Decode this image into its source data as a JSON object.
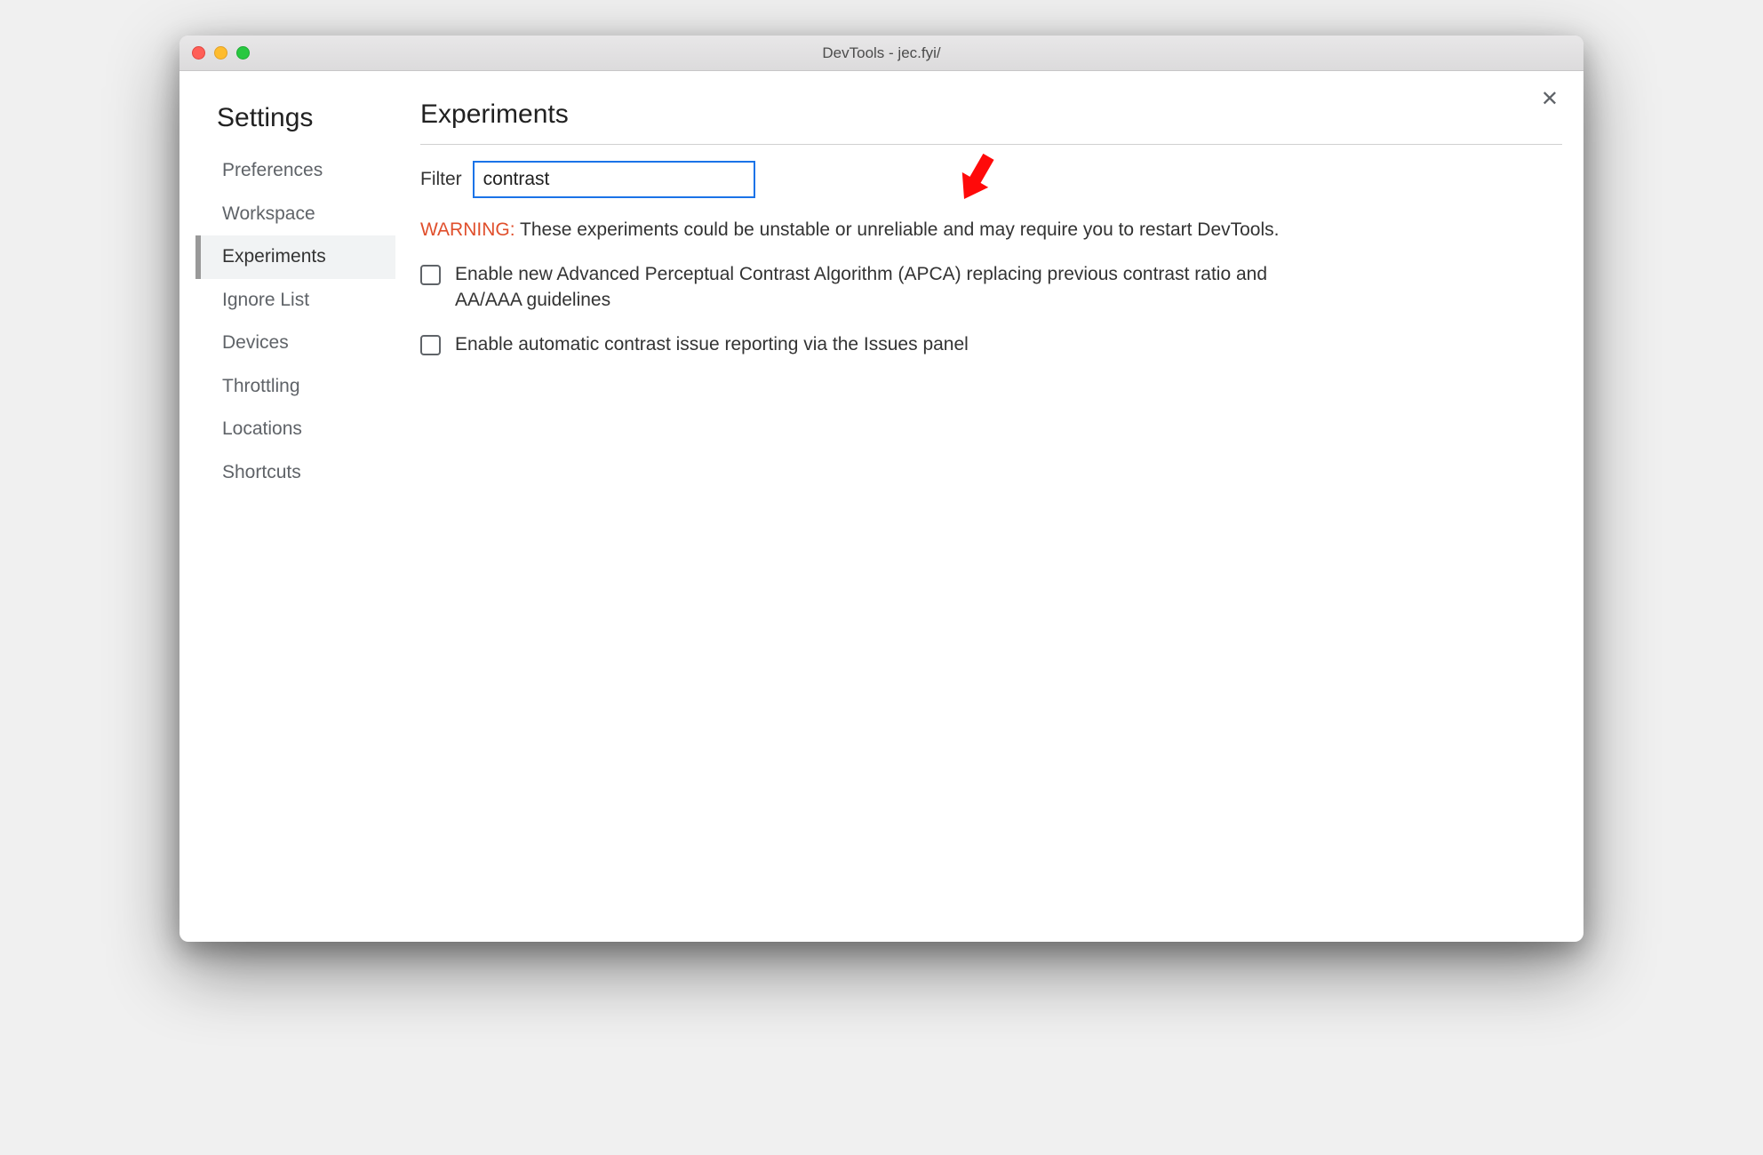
{
  "window": {
    "title": "DevTools - jec.fyi/"
  },
  "sidebar": {
    "title": "Settings",
    "items": [
      {
        "label": "Preferences",
        "active": false
      },
      {
        "label": "Workspace",
        "active": false
      },
      {
        "label": "Experiments",
        "active": true
      },
      {
        "label": "Ignore List",
        "active": false
      },
      {
        "label": "Devices",
        "active": false
      },
      {
        "label": "Throttling",
        "active": false
      },
      {
        "label": "Locations",
        "active": false
      },
      {
        "label": "Shortcuts",
        "active": false
      }
    ]
  },
  "main": {
    "title": "Experiments",
    "filter_label": "Filter",
    "filter_value": "contrast",
    "warning_prefix": "WARNING:",
    "warning_body": "These experiments could be unstable or unreliable and may require you to restart DevTools.",
    "experiments": [
      {
        "label": "Enable new Advanced Perceptual Contrast Algorithm (APCA) replacing previous contrast ratio and AA/AAA guidelines",
        "checked": false
      },
      {
        "label": "Enable automatic contrast issue reporting via the Issues panel",
        "checked": false
      }
    ]
  },
  "annotation": {
    "arrow_color": "#ff0a0a"
  }
}
